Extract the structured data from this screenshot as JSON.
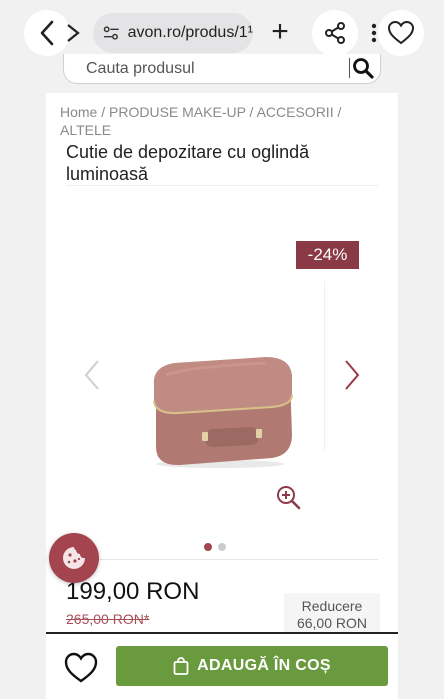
{
  "browser": {
    "url": "avon.ro/produs/1¹",
    "new_tab": "+"
  },
  "search": {
    "placeholder": "Cauta produsul"
  },
  "breadcrumb": "Home / PRODUSE MAKE-UP / ACCESORII / ALTELE",
  "product": {
    "title": "Cutie de depozitare cu oglindă luminoasă",
    "discount_badge": "-24%",
    "price": "199,00 RON",
    "old_price": "265,00 RON*",
    "discount_label": "Reducere",
    "discount_value": "66,00 RON",
    "case_color": "#b07a72"
  },
  "gallery": {
    "active_slide": 1,
    "total_slides": 2
  },
  "cart": {
    "add_label": "ADAUGĂ ÎN COȘ",
    "button_color": "#6a9a3e"
  }
}
